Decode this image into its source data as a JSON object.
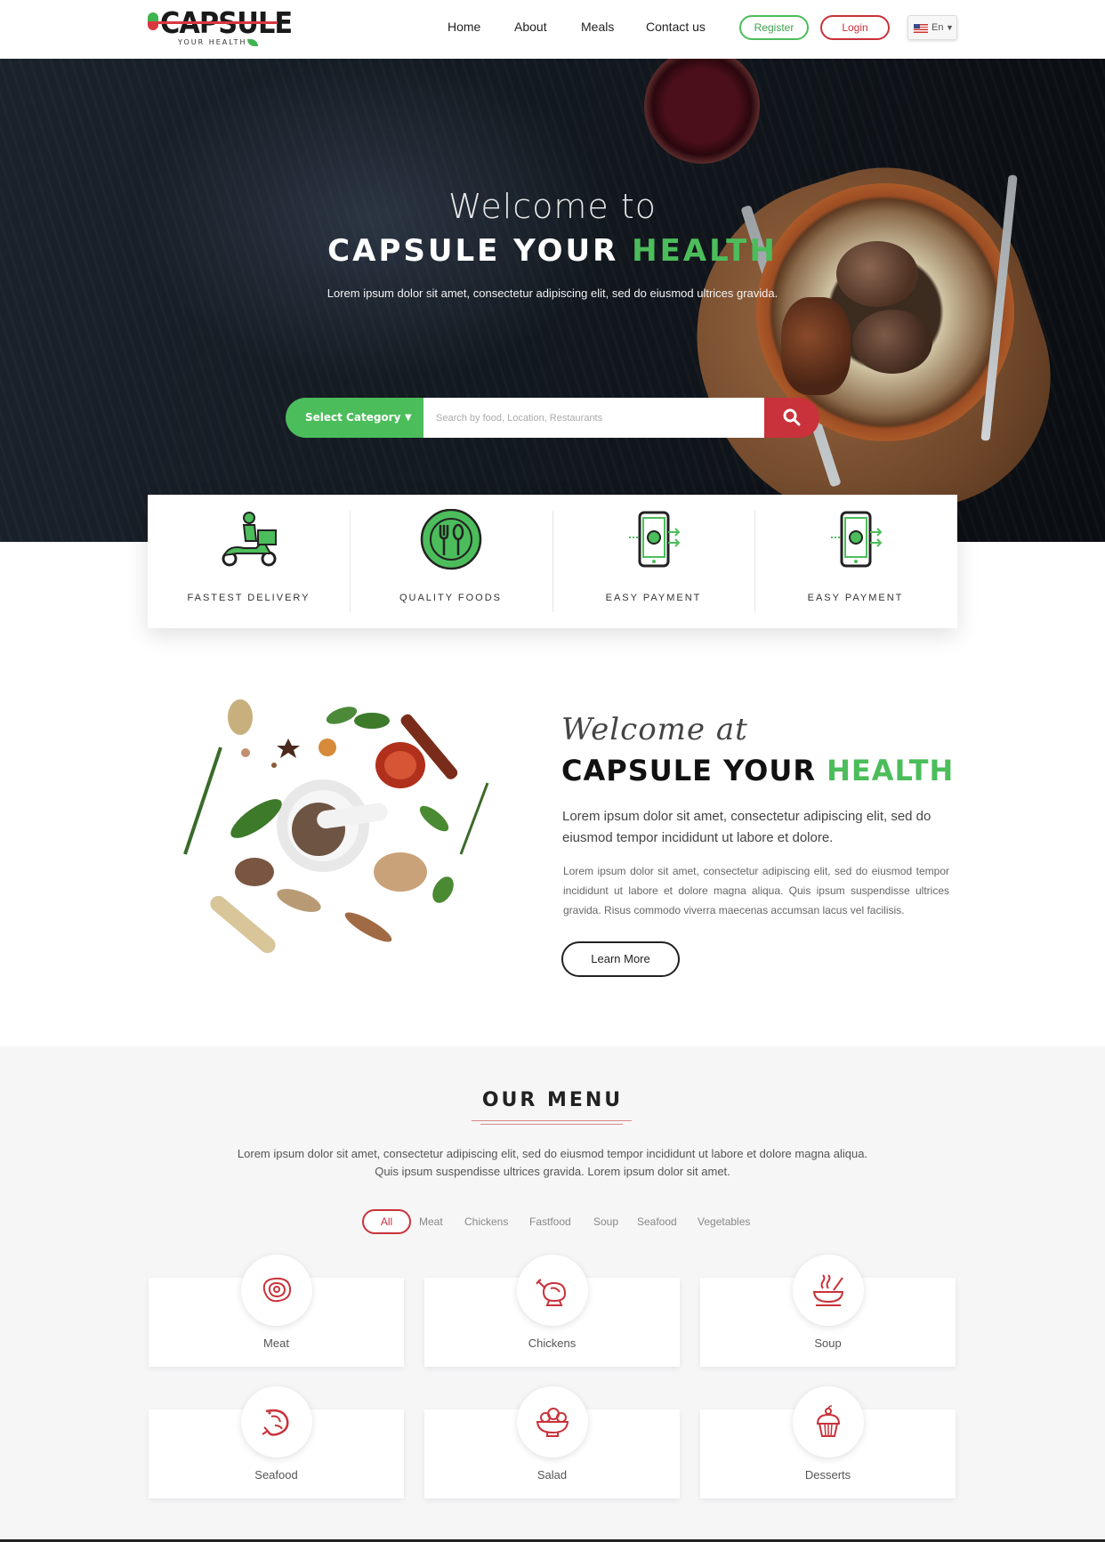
{
  "header": {
    "logo_text": "CAPSULE",
    "logo_sub": "YOUR HEALTH",
    "nav": [
      "Home",
      "About",
      "Meals",
      "Contact us"
    ],
    "register_label": "Register",
    "login_label": "Login",
    "language": "En"
  },
  "hero": {
    "welcome": "Welcome to",
    "title_main": "CAPSULE YOUR ",
    "title_accent": "HEALTH",
    "subtitle": "Lorem ipsum dolor sit amet, consectetur adipiscing elit, sed do eiusmod ultrices gravida.",
    "search": {
      "category_label": "Select Category",
      "placeholder": "Search by food, Location, Restaurants"
    }
  },
  "features": [
    {
      "label": "FASTEST DELIVERY",
      "icon": "delivery-scooter-icon"
    },
    {
      "label": "QUALITY FOODS",
      "icon": "fork-spoon-icon"
    },
    {
      "label": "EASY PAYMENT",
      "icon": "mobile-payment-icon"
    },
    {
      "label": "EASY PAYMENT",
      "icon": "mobile-payment-icon"
    }
  ],
  "about": {
    "script": "Welcome at",
    "title_main": "CAPSULE YOUR ",
    "title_accent": "HEALTH",
    "lead": "Lorem ipsum dolor sit amet, consectetur adipiscing elit, sed do eiusmod tempor incididunt ut labore et dolore.",
    "body": "Lorem ipsum dolor sit amet, consectetur adipiscing elit, sed do eiusmod tempor incididunt ut labore et dolore magna aliqua. Quis ipsum suspendisse ultrices gravida. Risus commodo viverra maecenas accumsan lacus vel facilisis.",
    "button_label": "Learn More"
  },
  "menu": {
    "title": "OUR MENU",
    "desc_line1": "Lorem ipsum dolor sit amet, consectetur adipiscing elit, sed do eiusmod tempor incididunt ut labore et dolore magna aliqua.",
    "desc_line2": "Quis ipsum suspendisse ultrices gravida. Lorem ipsum dolor sit amet.",
    "filters": [
      "All",
      "Meat",
      "Chickens",
      "Fastfood",
      "Soup",
      "Seafood",
      "Vegetables"
    ],
    "active_filter": "All",
    "categories": [
      {
        "label": "Meat",
        "icon": "steak-icon"
      },
      {
        "label": "Chickens",
        "icon": "roast-chicken-icon"
      },
      {
        "label": "Soup",
        "icon": "soup-bowl-icon"
      },
      {
        "label": "Seafood",
        "icon": "shrimp-icon"
      },
      {
        "label": "Salad",
        "icon": "salad-bowl-icon"
      },
      {
        "label": "Desserts",
        "icon": "cupcake-icon"
      }
    ]
  },
  "colors": {
    "accent_green": "#4cbd5b",
    "accent_red": "#c9323a",
    "dark": "#111111"
  }
}
